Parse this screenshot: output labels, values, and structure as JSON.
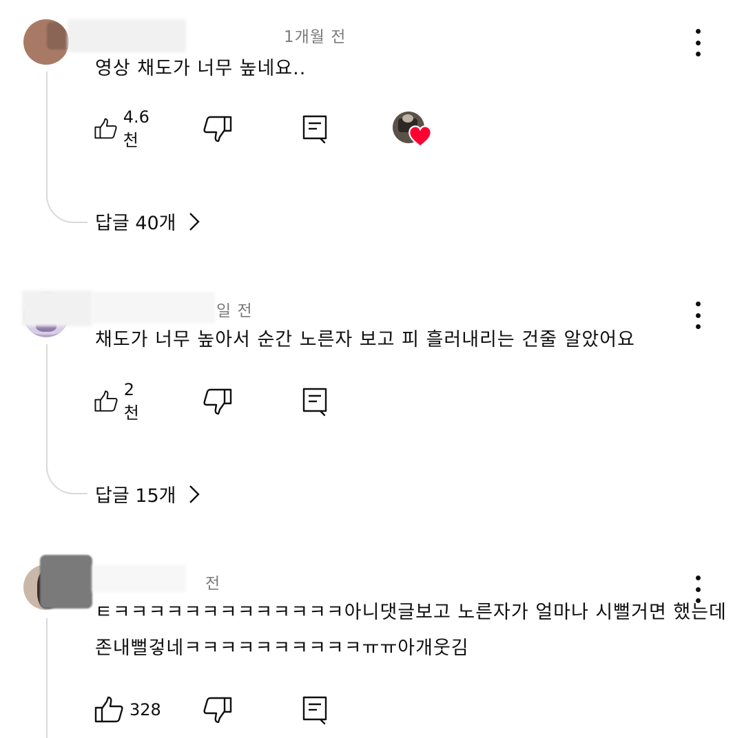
{
  "comments": [
    {
      "meta": "1개월 전",
      "text": "영상 채도가 너무 높네요..",
      "likes": "4.6천",
      "replies_label": "답글 40개",
      "creator_hearted": true
    },
    {
      "meta": "일 전",
      "text": "채도가 너무 높아서 순간 노른자 보고 피 흘러내리는 건줄 알았어요",
      "likes": "2천",
      "replies_label": "답글 15개",
      "creator_hearted": false
    },
    {
      "meta": "전",
      "text_lines": [
        "ㅌㅋㅋㅋㅋㅋㅋㅋㅋㅋㅋㅋㅋㅋ아니댓글보고 노른자가 얼마나 시뻘거면 했는데",
        "존내뻘겋네ㅋㅋㅋㅋㅋㅋㅋㅋㅋㅋㅠㅠ아개웃김"
      ],
      "likes": "328",
      "creator_hearted": false
    }
  ],
  "icons": {
    "like": "thumb-up-outline",
    "dislike": "thumb-down-outline",
    "reply": "comment-outline",
    "more": "three-dot-vertical",
    "heart": "creator-heart"
  },
  "colors": {
    "heart": "#ff0033",
    "meta_text": "#7a7a7a",
    "thread_line": "#d9d9d9"
  }
}
